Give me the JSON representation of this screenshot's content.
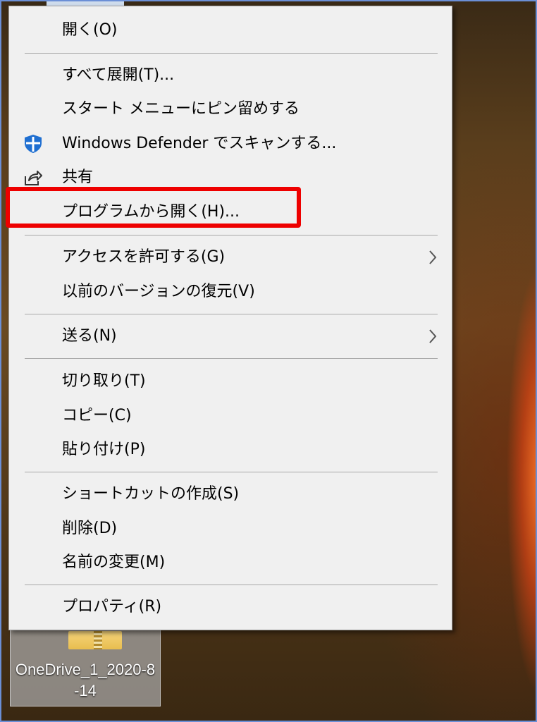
{
  "desktop": {
    "icon_label": "OneDrive_1_2020-8-14",
    "icon_name": "zip-folder-icon"
  },
  "context_menu": {
    "items": [
      {
        "label": "開く(O)",
        "icon": null,
        "submenu": false
      },
      {
        "label": "すべて展開(T)...",
        "icon": null,
        "submenu": false
      },
      {
        "label": "スタート メニューにピン留めする",
        "icon": null,
        "submenu": false
      },
      {
        "label": "Windows Defender でスキャンする...",
        "icon": "defender-shield-icon",
        "submenu": false
      },
      {
        "label": "共有",
        "icon": "share-icon",
        "submenu": false
      },
      {
        "label": "プログラムから開く(H)...",
        "icon": null,
        "submenu": false,
        "highlighted": true
      },
      {
        "label": "アクセスを許可する(G)",
        "icon": null,
        "submenu": true
      },
      {
        "label": "以前のバージョンの復元(V)",
        "icon": null,
        "submenu": false
      },
      {
        "label": "送る(N)",
        "icon": null,
        "submenu": true
      },
      {
        "label": "切り取り(T)",
        "icon": null,
        "submenu": false
      },
      {
        "label": "コピー(C)",
        "icon": null,
        "submenu": false
      },
      {
        "label": "貼り付け(P)",
        "icon": null,
        "submenu": false
      },
      {
        "label": "ショートカットの作成(S)",
        "icon": null,
        "submenu": false
      },
      {
        "label": "削除(D)",
        "icon": null,
        "submenu": false
      },
      {
        "label": "名前の変更(M)",
        "icon": null,
        "submenu": false
      },
      {
        "label": "プロパティ(R)",
        "icon": null,
        "submenu": false
      }
    ]
  },
  "colors": {
    "menu_background": "#f0f0f0",
    "highlight_border": "#ee0000",
    "defender_blue": "#1f6fd1"
  }
}
